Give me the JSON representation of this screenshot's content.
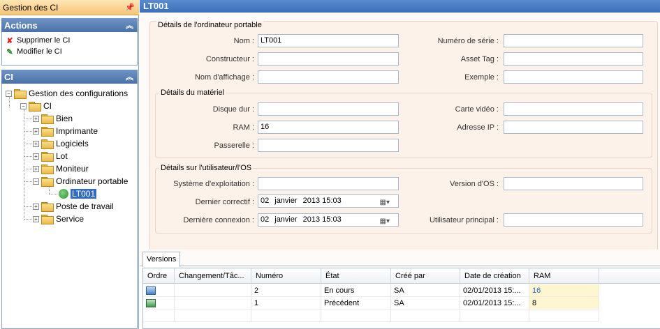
{
  "left_panel": {
    "header": "Gestion des CI",
    "actions_title": "Actions",
    "actions": [
      {
        "label": "Supprimer le CI",
        "icon": "delete-icon"
      },
      {
        "label": "Modifier le CI",
        "icon": "edit-icon"
      }
    ],
    "ci_title": "CI",
    "tree": {
      "root": "Gestion des configurations",
      "ci": "CI",
      "items": [
        "Bien",
        "Imprimante",
        "Logiciels",
        "Lot",
        "Moniteur",
        "Ordinateur portable",
        "Poste de travail",
        "Service"
      ],
      "selected_child": "LT001"
    }
  },
  "title": "LT001",
  "sections": {
    "details_title": "Détails de l'ordinateur portable",
    "hardware_title": "Détails du matériel",
    "user_title": "Détails sur l'utilisateur/l'OS"
  },
  "fields": {
    "nom_label": "Nom :",
    "nom_value": "LT001",
    "serie_label": "Numéro de série :",
    "serie_value": "",
    "constructeur_label": "Constructeur :",
    "constructeur_value": "",
    "asset_label": "Asset Tag :",
    "asset_value": "",
    "affichage_label": "Nom d'affichage :",
    "affichage_value": "",
    "exemple_label": "Exemple :",
    "exemple_value": "",
    "disque_label": "Disque dur :",
    "disque_value": "",
    "video_label": "Carte vidéo :",
    "video_value": "",
    "ram_label": "RAM :",
    "ram_value": "16",
    "ip_label": "Adresse IP :",
    "ip_value": "",
    "passerelle_label": "Passerelle :",
    "passerelle_value": "",
    "os_label": "Système d'exploitation :",
    "os_value": "",
    "osver_label": "Version d'OS :",
    "osver_value": "",
    "correctif_label": "Dernier correctif :",
    "correctif_day": "02",
    "correctif_month": "janvier",
    "correctif_year": "2013 15:03",
    "connexion_label": "Dernière connexion :",
    "connexion_day": "02",
    "connexion_month": "janvier",
    "connexion_year": "2013 15:03",
    "user_label": "Utilisateur principal :",
    "user_value": ""
  },
  "versions": {
    "tab": "Versions",
    "columns": [
      "Ordre",
      "Changement/Tâc...",
      "Numéro",
      "État",
      "Créé par",
      "Date de création",
      "RAM"
    ],
    "rows": [
      {
        "numero": "2",
        "etat": "En cours",
        "cree_par": "SA",
        "date": "02/01/2013 15:...",
        "ram": "16"
      },
      {
        "numero": "1",
        "etat": "Précédent",
        "cree_par": "SA",
        "date": "02/01/2013 15:...",
        "ram": "8"
      }
    ]
  },
  "colors": {
    "header_blue": "#3b6fb8",
    "group_bg": "#fcf2ea",
    "ram_highlight": "#fdf6d0"
  }
}
